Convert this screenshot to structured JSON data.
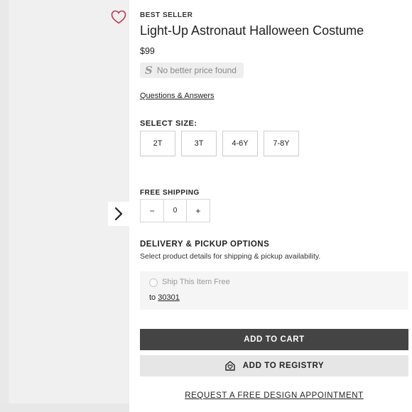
{
  "product": {
    "badge": "BEST SELLER",
    "title": "Light-Up Astronaut Halloween Costume",
    "price": "$99",
    "price_check": {
      "icon": "S",
      "text": "No better price found"
    },
    "qa_link": "Questions & Answers"
  },
  "size": {
    "label": "SELECT SIZE:",
    "options": [
      "2T",
      "3T",
      "4-6Y",
      "7-8Y"
    ]
  },
  "shipping": {
    "label": "FREE SHIPPING",
    "quantity": "0",
    "decrement": "−",
    "increment": "+"
  },
  "delivery": {
    "label": "DELIVERY & PICKUP OPTIONS",
    "subtitle": "Select product details for shipping & pickup availability.",
    "option_label": "Ship This Item Free",
    "to_text": "to",
    "zip": "30301"
  },
  "actions": {
    "add_to_cart": "ADD TO CART",
    "add_to_registry": "ADD TO REGISTRY",
    "appointment": "REQUEST A FREE DESIGN APPOINTMENT"
  },
  "colors": {
    "heart": "#c0394b",
    "cart_button": "#444444",
    "registry_button": "#e6e6e6"
  },
  "icons": [
    "heart-icon",
    "chevron-right-icon",
    "price-check-s-icon",
    "registry-house-heart-icon"
  ]
}
